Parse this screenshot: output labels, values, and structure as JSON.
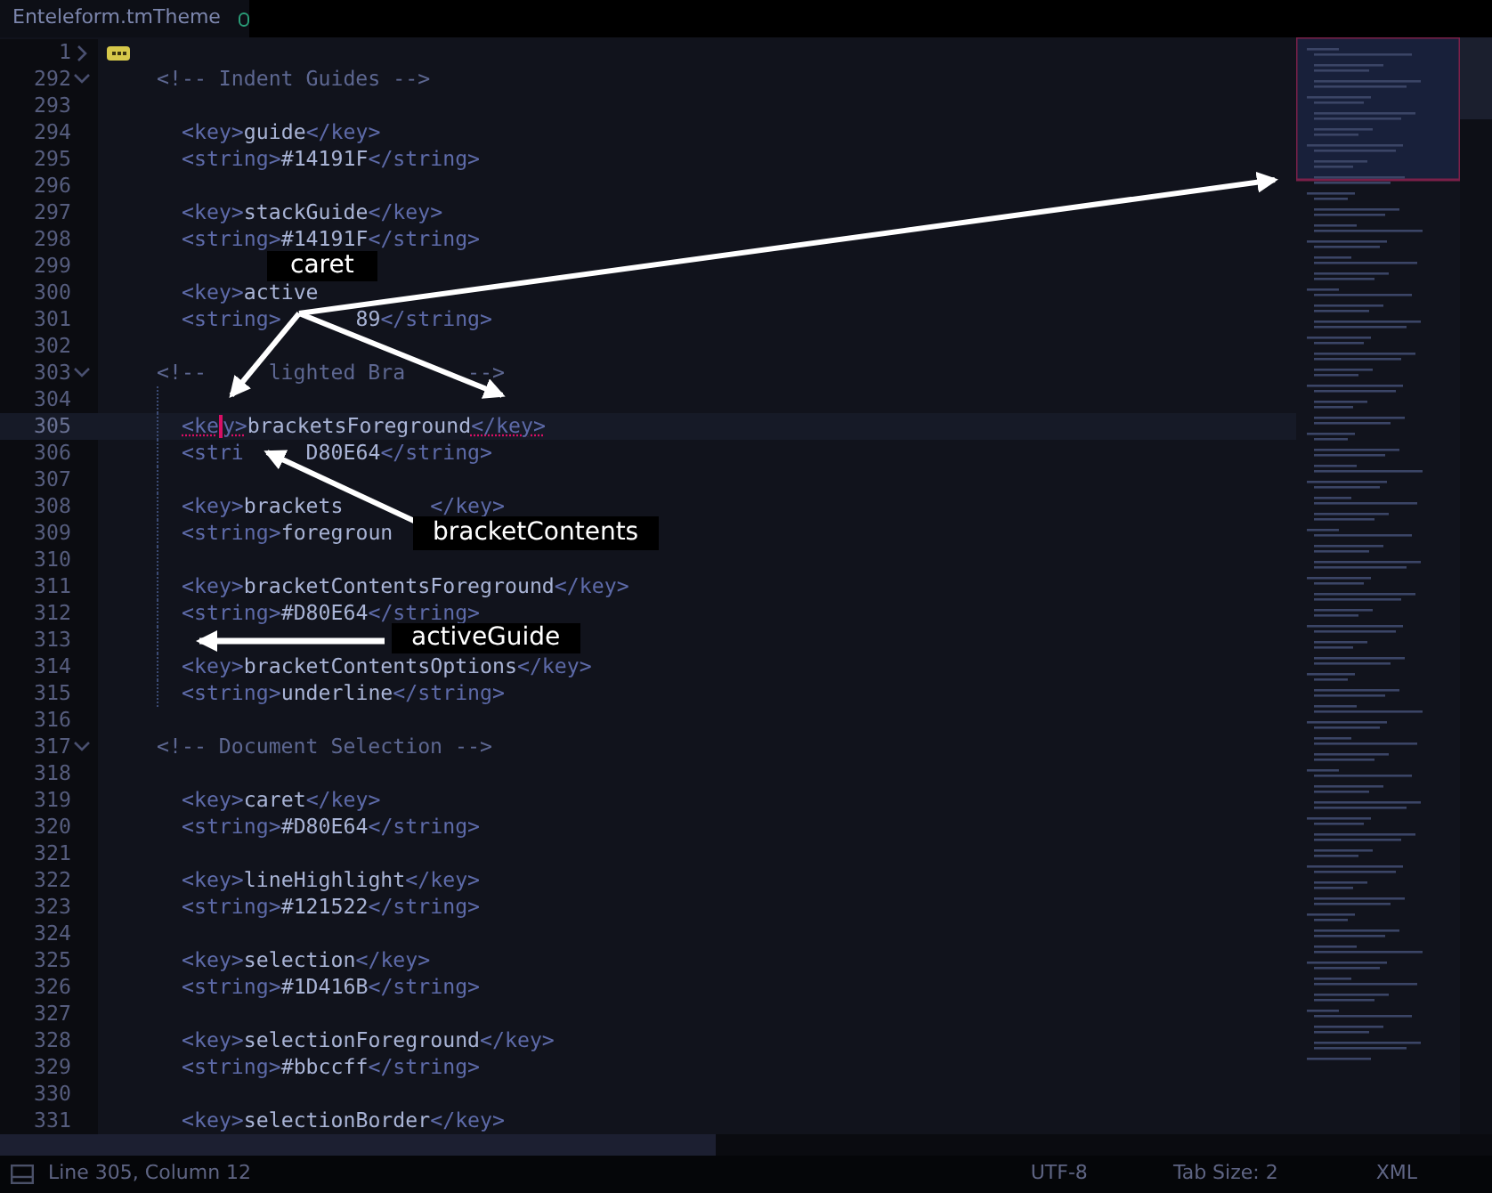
{
  "tab": {
    "title": "Enteleform.tmTheme",
    "dirty": true
  },
  "lines": [
    {
      "number": "1",
      "kind": "folded",
      "collapsed": true
    },
    {
      "number": "292",
      "kind": "comment",
      "text": "<!-- Indent Guides -->",
      "collapsed": false
    },
    {
      "number": "293",
      "kind": "blank"
    },
    {
      "number": "294",
      "kind": "code",
      "text": "<key>guide</key>"
    },
    {
      "number": "295",
      "kind": "code",
      "text": "<string>#14191F</string>"
    },
    {
      "number": "296",
      "kind": "blank"
    },
    {
      "number": "297",
      "kind": "code",
      "text": "<key>stackGuide</key>"
    },
    {
      "number": "298",
      "kind": "code",
      "text": "<string>#14191F</string>"
    },
    {
      "number": "299",
      "kind": "blank"
    },
    {
      "number": "300",
      "kind": "code",
      "text": "<key>active"
    },
    {
      "number": "301",
      "kind": "code",
      "text": "<string>      89</string>"
    },
    {
      "number": "302",
      "kind": "blank"
    },
    {
      "number": "303",
      "kind": "comment",
      "text": "<!--     lighted Bra     -->",
      "collapsed": false
    },
    {
      "number": "304",
      "kind": "blank",
      "guide": true
    },
    {
      "number": "305",
      "kind": "code",
      "guide": true,
      "current": true,
      "caret_after": "<ke",
      "text": "y>bracketsForeground</key>",
      "matched_brackets": true
    },
    {
      "number": "306",
      "kind": "code",
      "guide": true,
      "text": "<stri     D80E64</string>"
    },
    {
      "number": "307",
      "kind": "blank",
      "guide": true
    },
    {
      "number": "308",
      "kind": "code",
      "guide": true,
      "text": "<key>brackets       </key>"
    },
    {
      "number": "309",
      "kind": "code",
      "guide": true,
      "text": "<string>foregroun"
    },
    {
      "number": "310",
      "kind": "blank",
      "guide": true
    },
    {
      "number": "311",
      "kind": "code",
      "guide": true,
      "text": "<key>bracketContentsForeground</key>"
    },
    {
      "number": "312",
      "kind": "code",
      "guide": true,
      "text": "<string>#D80E64</string>"
    },
    {
      "number": "313",
      "kind": "blank",
      "guide": true
    },
    {
      "number": "314",
      "kind": "code",
      "guide": true,
      "text": "<key>bracketContentsOptions</key>"
    },
    {
      "number": "315",
      "kind": "code",
      "guide": true,
      "text": "<string>underline</string>"
    },
    {
      "number": "316",
      "kind": "blank"
    },
    {
      "number": "317",
      "kind": "comment",
      "text": "<!-- Document Selection -->",
      "collapsed": false
    },
    {
      "number": "318",
      "kind": "blank"
    },
    {
      "number": "319",
      "kind": "code",
      "text": "<key>caret</key>"
    },
    {
      "number": "320",
      "kind": "code",
      "text": "<string>#D80E64</string>"
    },
    {
      "number": "321",
      "kind": "blank"
    },
    {
      "number": "322",
      "kind": "code",
      "text": "<key>lineHighlight</key>"
    },
    {
      "number": "323",
      "kind": "code",
      "text": "<string>#121522</string>"
    },
    {
      "number": "324",
      "kind": "blank"
    },
    {
      "number": "325",
      "kind": "code",
      "text": "<key>selection</key>"
    },
    {
      "number": "326",
      "kind": "code",
      "text": "<string>#1D416B</string>"
    },
    {
      "number": "327",
      "kind": "blank"
    },
    {
      "number": "328",
      "kind": "code",
      "text": "<key>selectionForeground</key>"
    },
    {
      "number": "329",
      "kind": "code",
      "text": "<string>#bbccff</string>"
    },
    {
      "number": "330",
      "kind": "blank"
    },
    {
      "number": "331",
      "kind": "code",
      "text": "<key>selectionBorder</key>"
    }
  ],
  "annotations": [
    "caret",
    "bracketContents",
    "activeGuide"
  ],
  "status_bar": {
    "position": "Line 305, Column 12",
    "encoding": "UTF-8",
    "tab_size": "Tab Size: 2",
    "syntax": "XML"
  }
}
